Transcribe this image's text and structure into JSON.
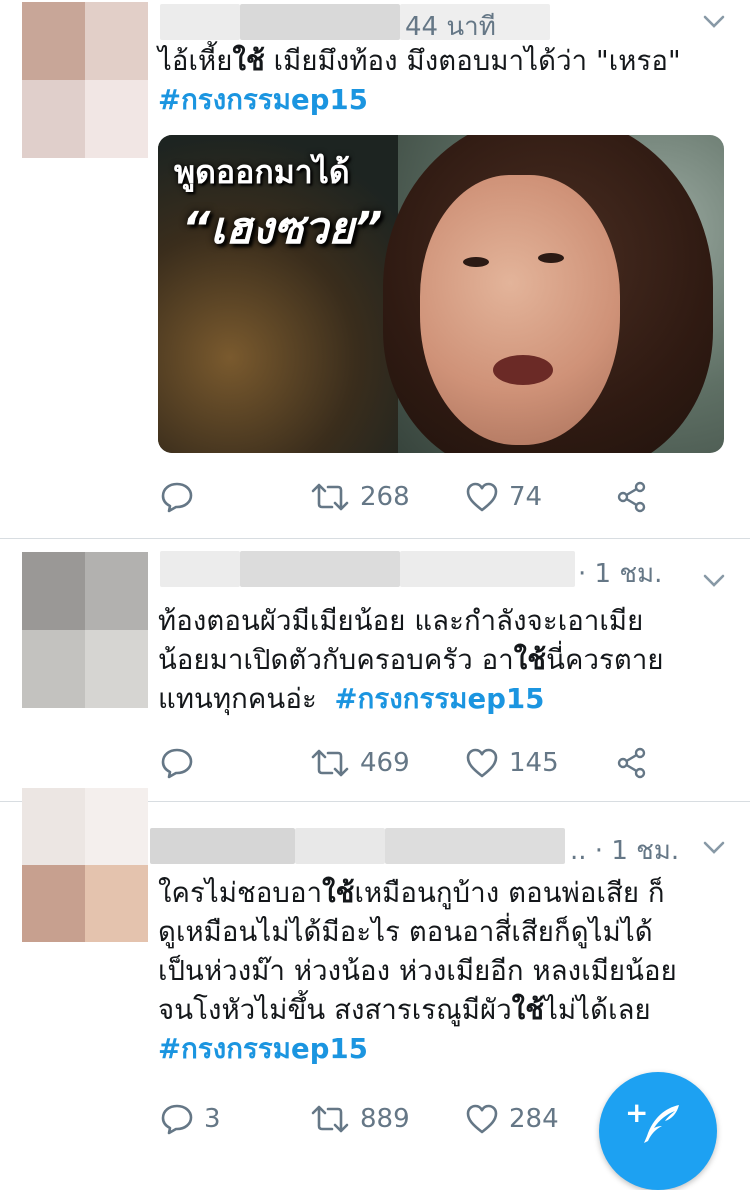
{
  "colors": {
    "accent": "#1da1f2",
    "hashtag": "#1b95e0",
    "muted": "#657786",
    "text": "#14171a",
    "divider": "#d8dde1"
  },
  "tweets": [
    {
      "time": "44 นาที",
      "body_parts": [
        {
          "t": "ไอ้เหี้ย"
        },
        {
          "t": "ใช้",
          "bold": true
        },
        {
          "t": " เมียมึงท้อง มึงตอบมาได้ว่า \"เหรอ\""
        }
      ],
      "hashtag": "#กรงกรรมep15",
      "media": {
        "caption_line1": "พูดออกมาได้",
        "caption_line2": "“เฮงซวย”"
      },
      "reply_count": "",
      "retweet_count": "268",
      "like_count": "74",
      "icons": {
        "reply": "reply-icon",
        "retweet": "retweet-icon",
        "like": "heart-icon",
        "share": "share-icon",
        "caret": "chevron-down-icon"
      }
    },
    {
      "time": "· 1 ชม.",
      "body_lines": [
        [
          {
            "t": "ท้องตอนผัวมีเมียน้อย และกำลังจะเอาเมีย"
          }
        ],
        [
          {
            "t": "น้อยมาเปิดตัวกับครอบครัว อา"
          },
          {
            "t": "ใช้",
            "bold": true
          },
          {
            "t": "นี่ควรตาย"
          }
        ],
        [
          {
            "t": "แทนทุกคนอ่ะ  "
          }
        ]
      ],
      "hashtag": "#กรงกรรมep15",
      "reply_count": "",
      "retweet_count": "469",
      "like_count": "145"
    },
    {
      "time": ".. · 1 ชม.",
      "body_lines": [
        [
          {
            "t": "ใครไม่ชอบอา"
          },
          {
            "t": "ใช้",
            "bold": true
          },
          {
            "t": "เหมือนกูบ้าง ตอนพ่อเสีย ก็"
          }
        ],
        [
          {
            "t": "ดูเหมือนไม่ได้มีอะไร ตอนอาสี่เสียก็ดูไม่ได้"
          }
        ],
        [
          {
            "t": "เป็นห่วงม๊า ห่วงน้อง ห่วงเมียอีก หลงเมียน้อย"
          }
        ],
        [
          {
            "t": "จนโงหัวไม่ขึ้น สงสารเรณูมีผัว"
          },
          {
            "t": "ใช้",
            "bold": true
          },
          {
            "t": "ไม่ได้เลย"
          }
        ]
      ],
      "hashtag": "#กรงกรรมep15",
      "reply_count": "3",
      "retweet_count": "889",
      "like_count": "284"
    }
  ],
  "compose_button": {
    "icon": "compose-feather-icon",
    "glyph": "+"
  }
}
